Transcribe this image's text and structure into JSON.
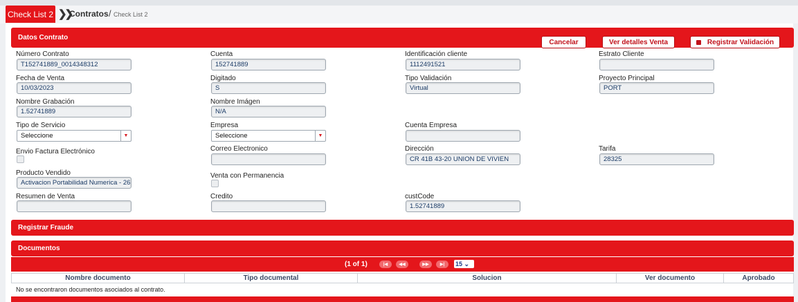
{
  "breadcrumb": {
    "tab": "Check List 2",
    "separator": "❯❯",
    "main": "Contratos",
    "slash": "/",
    "sub": "Check List 2"
  },
  "header": {
    "title": "Datos Contrato",
    "cancel": "Cancelar",
    "details": "Ver detalles Venta",
    "register": "Registrar Validación"
  },
  "fields": {
    "numero_contrato": {
      "label": "Número Contrato",
      "value": "T152741889_0014348312"
    },
    "cuenta": {
      "label": "Cuenta",
      "value": "152741889"
    },
    "identificacion": {
      "label": "Identificación cliente",
      "value": "1112491521"
    },
    "estrato": {
      "label": "Estrato Cliente",
      "value": ""
    },
    "fecha_venta": {
      "label": "Fecha de Venta",
      "value": "10/03/2023"
    },
    "digitado": {
      "label": "Digitado",
      "value": "S"
    },
    "tipo_validacion": {
      "label": "Tipo Validación",
      "value": "Virtual"
    },
    "proyecto": {
      "label": "Proyecto Principal",
      "value": "PORT"
    },
    "nombre_grabacion": {
      "label": "Nombre Grabación",
      "value": "1.52741889"
    },
    "nombre_imagen": {
      "label": "Nombre Imágen",
      "value": "N/A"
    },
    "tipo_servicio": {
      "label": "Tipo de Servicio",
      "value": "Seleccione"
    },
    "empresa": {
      "label": "Empresa",
      "value": "Seleccione"
    },
    "cuenta_empresa": {
      "label": "Cuenta Empresa",
      "value": ""
    },
    "envio_factura": {
      "label": "Envio Factura Electrónico"
    },
    "correo": {
      "label": "Correo Electronico",
      "value": ""
    },
    "direccion": {
      "label": "Dirección",
      "value": "CR 41B 43-20 UNION DE VIVIEN"
    },
    "tarifa": {
      "label": "Tarifa",
      "value": "28325"
    },
    "producto": {
      "label": "Producto Vendido",
      "value": "Activacion Portabilidad Numerica - 26"
    },
    "permanencia": {
      "label": "Venta con Permanencia"
    },
    "resumen": {
      "label": "Resumen de Venta",
      "value": ""
    },
    "credito": {
      "label": "Credito",
      "value": ""
    },
    "custcode": {
      "label": "custCode",
      "value": "1.52741889"
    }
  },
  "fraude": {
    "title": "Registrar Fraude"
  },
  "documentos": {
    "title": "Documentos",
    "pager_info": "(1 of 1)",
    "rows_per_page": "15",
    "columns": [
      "Nombre documento",
      "Tipo documental",
      "Solucion",
      "Ver documento",
      "Aprobado"
    ],
    "empty": "No se encontraron documentos asociados al contrato."
  },
  "colors": {
    "accent": "#e4161b"
  }
}
